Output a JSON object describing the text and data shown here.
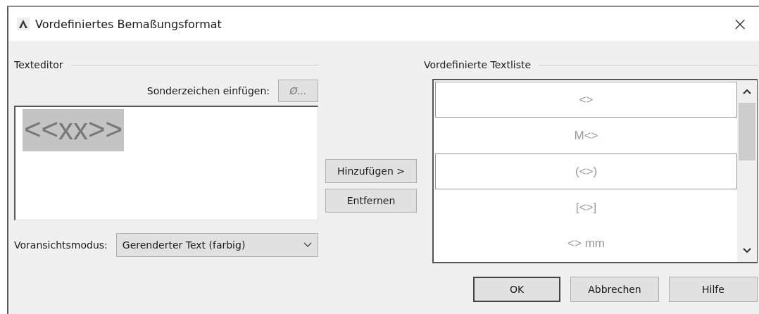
{
  "window": {
    "title": "Vordefiniertes Bemaßungsformat",
    "close": "×"
  },
  "text_editor": {
    "heading": "Texteditor",
    "special_chars_label": "Sonderzeichen einfügen:",
    "special_chars_button": "Ø...",
    "content": "<<xx>>",
    "content_selected": true,
    "preview_label": "Voransichtsmodus:",
    "preview_mode": "Gerenderter Text (farbig)"
  },
  "middle_buttons": [
    "Hinzufügen >",
    "Entfernen"
  ],
  "text_list": {
    "heading": "Vordefinierte Textliste",
    "items": [
      {
        "text": "<>",
        "framed": true
      },
      {
        "text": "M<>",
        "framed": false
      },
      {
        "text": "(<>)",
        "framed": true
      },
      {
        "text": "[<>]",
        "framed": false
      },
      {
        "text": "<> mm",
        "framed": false
      }
    ]
  },
  "buttons": [
    {
      "label": "OK",
      "default": true
    },
    {
      "label": "Abbrechen",
      "default": false
    },
    {
      "label": "Hilfe",
      "default": false
    }
  ]
}
